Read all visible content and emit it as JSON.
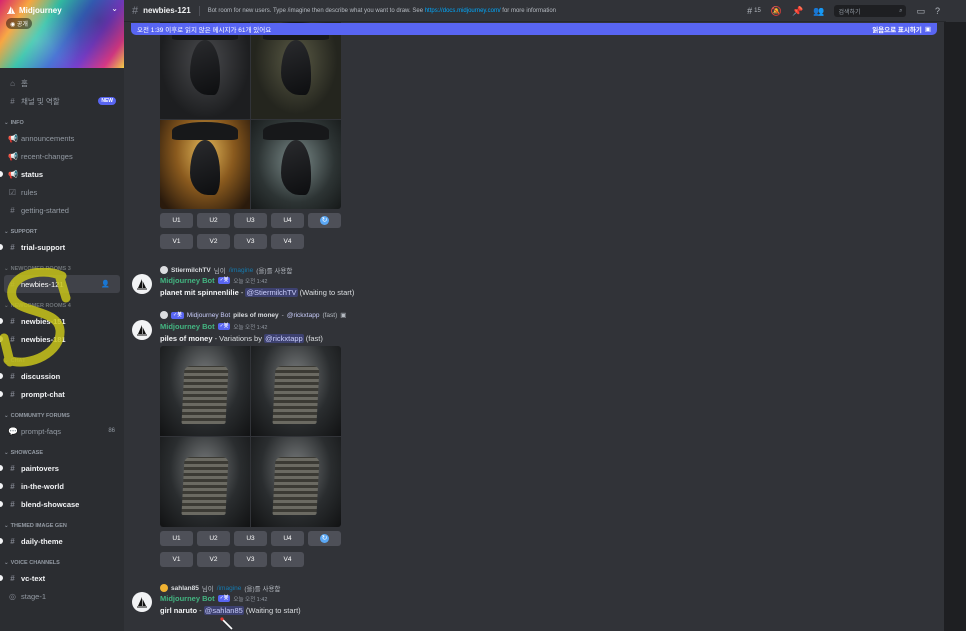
{
  "server": {
    "name": "Midjourney",
    "visibility": "공개"
  },
  "sidebar": {
    "home": "홈",
    "channels_roles": "채널 및 역할",
    "new_badge": "NEW",
    "categories": {
      "info": "INFO",
      "support": "SUPPORT",
      "newcomer3": "NEWCOMER ROOMS 3",
      "newcomer4": "NEWCOMER ROOMS 4",
      "chat": "CHAT",
      "forums": "COMMUNITY FORUMS",
      "showcase": "SHOWCASE",
      "themed": "THEMED IMAGE GEN",
      "voice": "VOICE CHANNELS"
    },
    "channels": {
      "announcements": "announcements",
      "recent_changes": "recent-changes",
      "status": "status",
      "rules": "rules",
      "getting_started": "getting-started",
      "trial_support": "trial-support",
      "newbies_121": "newbies-121",
      "newbies_151": "newbies-151",
      "newbies_181": "newbies-181",
      "discussion": "discussion",
      "prompt_chat": "prompt-chat",
      "prompt_faqs": "prompt-faqs",
      "prompt_faqs_count": "86",
      "paintovers": "paintovers",
      "in_the_world": "in-the-world",
      "blend_showcase": "blend-showcase",
      "daily_theme": "daily-theme",
      "vc_text": "vc-text",
      "stage_1": "stage-1"
    }
  },
  "topbar": {
    "channel": "newbies-121",
    "topic_prefix": "Bot room for new users. Type /imagine then describe what you want to draw. See ",
    "topic_link": "https://docs.midjourney.com/",
    "topic_suffix": " for more information",
    "thread_count": "15",
    "search_placeholder": "검색하기"
  },
  "unread_bar": {
    "text": "오전 1:39 이후로 읽지 않은 메시지가 61개 있어요",
    "mark_read": "읽음으로 표시하기"
  },
  "buttons": {
    "u": [
      "U1",
      "U2",
      "U3",
      "U4"
    ],
    "v": [
      "V1",
      "V2",
      "V3",
      "V4"
    ]
  },
  "messages": [
    {
      "reply_user": "StiermilchTV",
      "reply_mid": " 님이 ",
      "reply_cmd": "/imagine",
      "reply_end": "(을)를 사용함",
      "author": "Midjourney Bot",
      "bot_tag": "✓봇",
      "time": "오늘 오전 1:42",
      "prompt": "planet mit spinnenlilie",
      "dash": " - ",
      "mention": "@StiermilchTV",
      "status": " (Waiting to start)"
    },
    {
      "reply_author": "Midjourney Bot",
      "reply_prompt": "piles of money",
      "reply_dash": " - ",
      "reply_mention": "@rickxtapp",
      "reply_status": " (fast)",
      "author": "Midjourney Bot",
      "bot_tag": "✓봇",
      "time": "오늘 오전 1:42",
      "prompt": "piles of money",
      "middle": " - Variations by ",
      "mention": "@rickxtapp",
      "status": " (fast)"
    },
    {
      "reply_user": "sahlan85",
      "reply_mid": " 님이 ",
      "reply_cmd": "/imagine",
      "reply_end": "(을)를 사용함",
      "author": "Midjourney Bot",
      "bot_tag": "✓봇",
      "time": "오늘 오전 1:42",
      "prompt": "girl naruto",
      "dash": " - ",
      "mention": "@sahlan85",
      "status": " (Waiting to start)"
    }
  ],
  "colors": {
    "accent": "#5865f2",
    "bot_name": "#43b581",
    "link": "#00a8fc",
    "scribble": "#c8c41a"
  }
}
